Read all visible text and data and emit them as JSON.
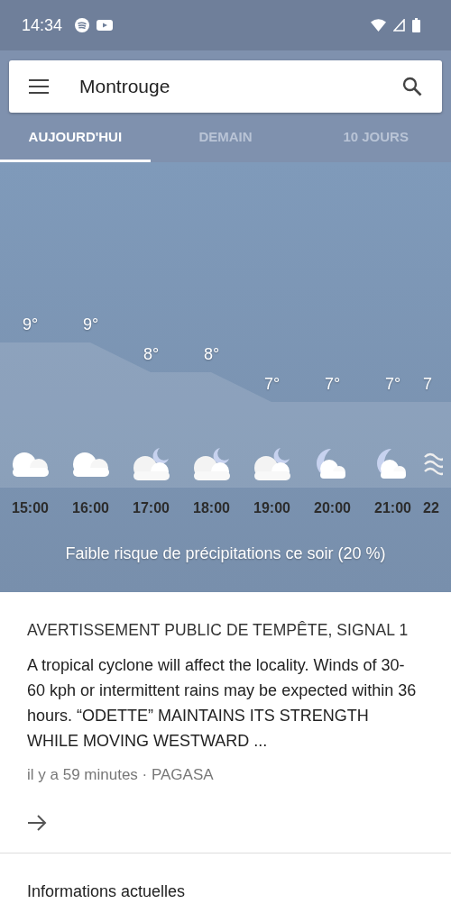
{
  "status_bar": {
    "time": "14:34"
  },
  "search": {
    "value": "Montrouge"
  },
  "tabs": [
    {
      "label": "AUJOURD'HUI",
      "selected": true
    },
    {
      "label": "DEMAIN",
      "selected": false
    },
    {
      "label": "10 JOURS",
      "selected": false
    }
  ],
  "hourly": [
    {
      "temp": "9°",
      "kind": "cloudy",
      "time": "15:00"
    },
    {
      "temp": "9°",
      "kind": "cloudy",
      "time": "16:00"
    },
    {
      "temp": "8°",
      "kind": "cloudynight",
      "time": "17:00"
    },
    {
      "temp": "8°",
      "kind": "cloudynight",
      "time": "18:00"
    },
    {
      "temp": "7°",
      "kind": "cloudynight",
      "time": "19:00"
    },
    {
      "temp": "7°",
      "kind": "night",
      "time": "20:00"
    },
    {
      "temp": "7°",
      "kind": "night",
      "time": "21:00"
    },
    {
      "temp": "7",
      "kind": "fog",
      "time": "22"
    }
  ],
  "precipitation_note": "Faible risque de précipitations ce soir (20 %)",
  "alert": {
    "title": "AVERTISSEMENT PUBLIC DE TEMPÊTE, SIGNAL 1",
    "body": "A tropical cyclone will affect the locality. Winds of 30-60 kph or intermittent rains may be expected within 36 hours. “ODETTE” MAINTAINS ITS STRENGTH WHILE MOVING WESTWARD ...",
    "meta": "il y a 59 minutes · PAGASA"
  },
  "section_title": "Informations actuelles"
}
